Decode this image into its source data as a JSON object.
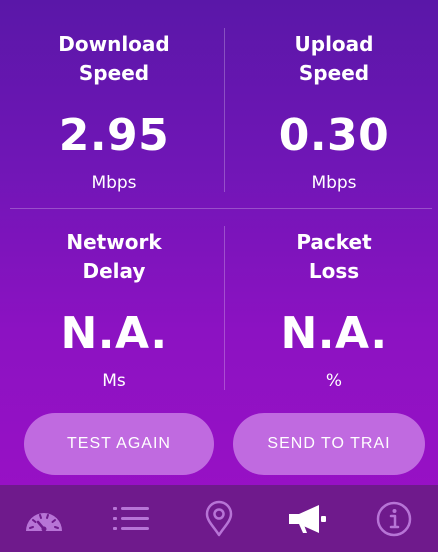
{
  "metrics": {
    "download": {
      "label": "Download\nSpeed",
      "value": "2.95",
      "unit": "Mbps"
    },
    "upload": {
      "label": "Upload\nSpeed",
      "value": "0.30",
      "unit": "Mbps"
    },
    "delay": {
      "label": "Network\nDelay",
      "value": "N.A.",
      "unit": "Ms"
    },
    "loss": {
      "label": "Packet\nLoss",
      "value": "N.A.",
      "unit": "%"
    }
  },
  "actions": {
    "test_again": "TEST AGAIN",
    "send_to_trai": "SEND TO TRAI"
  },
  "nav": [
    {
      "icon": "speedometer-icon",
      "active": false
    },
    {
      "icon": "list-icon",
      "active": false
    },
    {
      "icon": "location-pin-icon",
      "active": false
    },
    {
      "icon": "megaphone-icon",
      "active": true
    },
    {
      "icon": "info-icon",
      "active": false
    }
  ],
  "colors": {
    "gradient_top": "#5a17a8",
    "gradient_bottom": "#9c10c6",
    "button": "#c06ae0",
    "navbar": "#6f1a8c",
    "nav_icon_inactive": "#b774d6",
    "nav_icon_active": "#ffffff"
  }
}
